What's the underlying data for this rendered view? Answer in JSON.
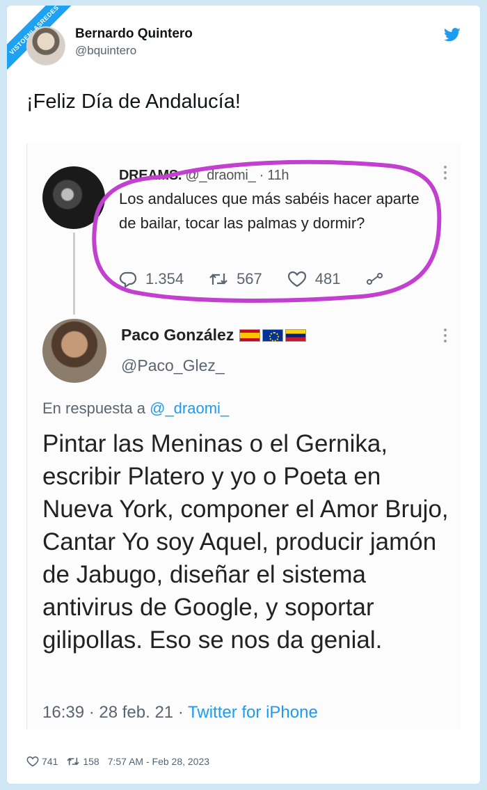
{
  "watermark": {
    "text": "VISTOENLASREDES"
  },
  "author": {
    "name": "Bernardo Quintero",
    "handle": "@bquintero"
  },
  "tweet": {
    "text": "¡Feliz Día de Andalucía!"
  },
  "quoted": {
    "name": "DREAMS.",
    "handle_time": "@_draomi_ · 11h",
    "text": "Los andaluces que más sabéis hacer aparte de bailar, tocar las palmas y dormir?",
    "stats": {
      "replies": "1.354",
      "retweets": "567",
      "likes": "481"
    }
  },
  "reply": {
    "name": "Paco González",
    "handle": "@Paco_Glez_",
    "reply_prefix": "En respuesta a ",
    "reply_to": "@_draomi_",
    "text": "Pintar las Meninas o el Gernika, escribir Platero y yo o Poeta en Nueva York, componer el Amor Brujo, Cantar Yo soy Aquel, producir jamón de Jabugo, diseñar el sistema antivirus de Google, y soportar gilipollas. Eso se nos da genial.",
    "time": "16:39 · 28 feb. 21 · ",
    "source": "Twitter for iPhone"
  },
  "footer": {
    "likes": "741",
    "retweets": "158",
    "timestamp": "7:57 AM - Feb 28, 2023"
  },
  "icons": [
    "twitter-bird-icon",
    "reply-icon",
    "retweet-icon",
    "like-icon",
    "share-icon",
    "more-icon"
  ],
  "colors": {
    "accent": "#1d9bf0",
    "highlight_circle": "#c23fd0",
    "background": "#cfe6f5"
  }
}
